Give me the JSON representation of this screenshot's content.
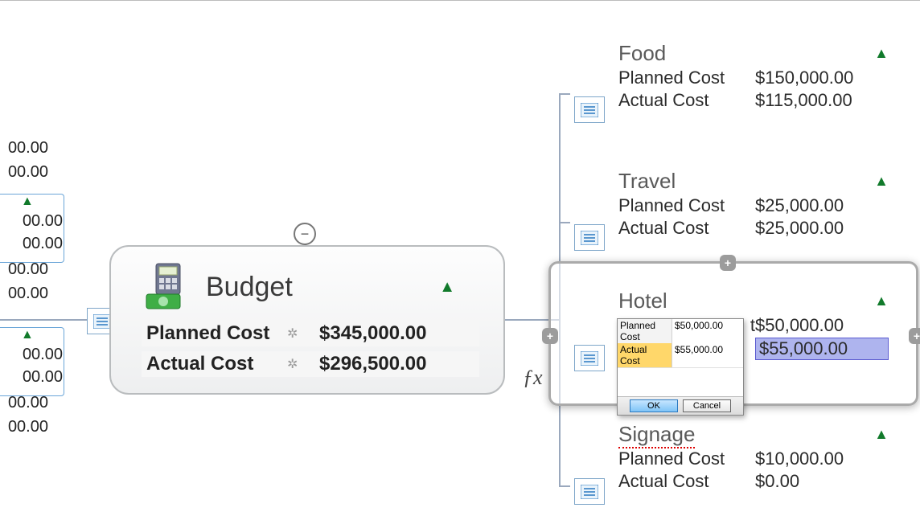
{
  "cropped": {
    "g1": {
      "v1": "00.00",
      "v2": "00.00"
    },
    "g2": {
      "v1": "00.00",
      "v2": "00.00"
    },
    "g3": {
      "v1": "00.00",
      "v2": "00.00"
    }
  },
  "budget": {
    "title": "Budget",
    "rows": [
      {
        "label": "Planned Cost",
        "value": "$345,000.00"
      },
      {
        "label": "Actual Cost",
        "value": "$296,500.00"
      }
    ]
  },
  "fx": "ƒx",
  "children": [
    {
      "title": "Food",
      "planned_label": "Planned Cost",
      "planned_value": "$150,000.00",
      "actual_label": "Actual Cost",
      "actual_value": "$115,000.00"
    },
    {
      "title": "Travel",
      "planned_label": "Planned Cost",
      "planned_value": "$25,000.00",
      "actual_label": "Actual Cost",
      "actual_value": "$25,000.00"
    },
    {
      "title": "Hotel",
      "planned_label": "Planned Cost",
      "planned_value": "$50,000.00",
      "actual_label": "Actual Cost",
      "actual_value": "$55,000.00"
    },
    {
      "title": "Signage",
      "planned_label": "Planned Cost",
      "planned_value": "$10,000.00",
      "actual_label": "Actual Cost",
      "actual_value": "$0.00"
    }
  ],
  "popup": {
    "rows": [
      {
        "label": "Planned Cost",
        "value": "$50,000.00",
        "active": false
      },
      {
        "label": "Actual Cost",
        "value": "$55,000.00",
        "active": true
      }
    ],
    "ok": "OK",
    "cancel": "Cancel"
  },
  "partial_char": "t"
}
